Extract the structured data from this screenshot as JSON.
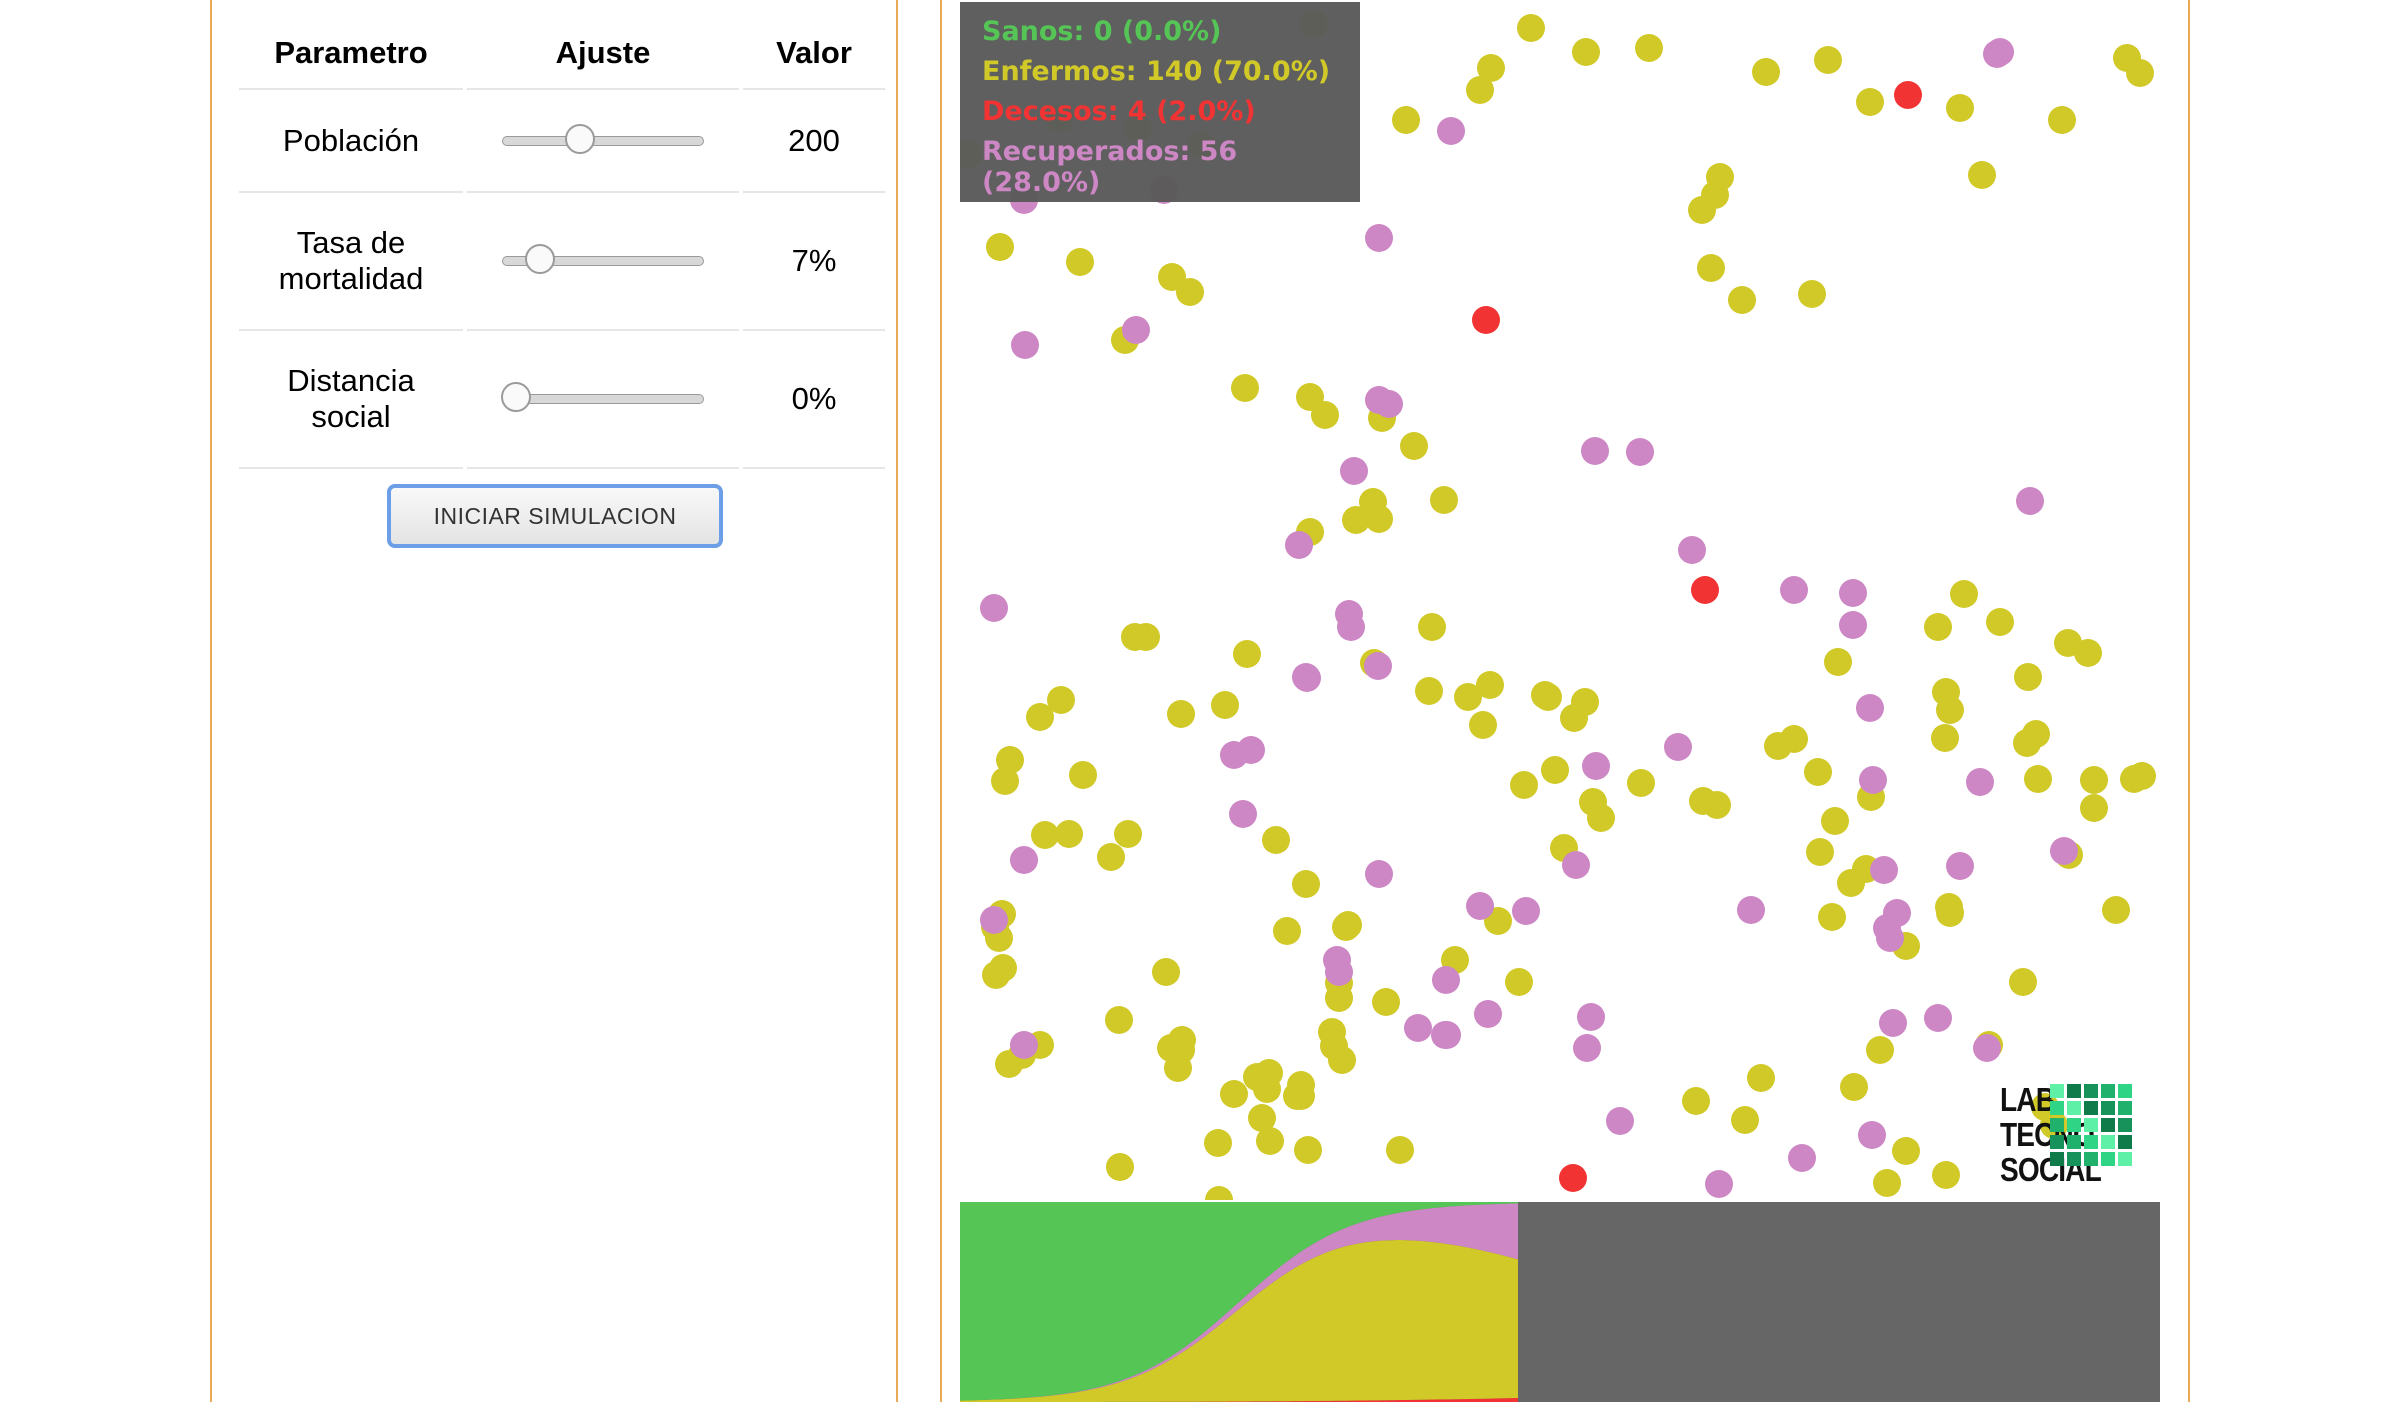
{
  "table": {
    "headers": [
      "Parametro",
      "Ajuste",
      "Valor"
    ],
    "rows": [
      {
        "label": "Población",
        "value": "200",
        "slider_fraction": 0.37
      },
      {
        "label": "Tasa de\nmortalidad",
        "value": "7%",
        "slider_fraction": 0.14
      },
      {
        "label": "Distancia\nsocial",
        "value": "0%",
        "slider_fraction": 0.0
      }
    ]
  },
  "start_button": {
    "label": "INICIAR SIMULACION"
  },
  "legend": {
    "healthy": "Sanos: 0 (0.0%)",
    "sick": "Enfermos: 140 (70.0%)",
    "deaths": "Decesos: 4 (2.0%)",
    "recovered": "Recuperados: 56 (28.0%)"
  },
  "colors": {
    "healthy": "#55c656",
    "sick": "#d1c927",
    "deaths": "#f23334",
    "recovered": "#cd87c4",
    "legend_bg": "#5a5a5a",
    "frame": "#e8a95a"
  },
  "logo": {
    "text": "LAB\nTECNO\nSOCIAL"
  },
  "chart_data": {
    "type": "area",
    "stacked_categories": [
      "Sanos",
      "Enfermos",
      "Decesos",
      "Recuperados"
    ],
    "progress_fraction": 0.465,
    "final": {
      "Sanos": 0,
      "Enfermos": 140,
      "Decesos": 4,
      "Recuperados": 56
    },
    "population": 200
  }
}
